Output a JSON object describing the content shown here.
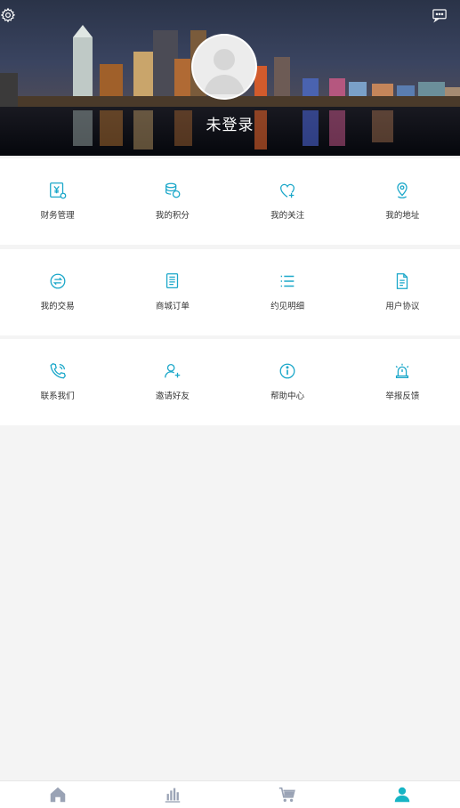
{
  "header": {
    "login_status": "未登录",
    "settings_icon": "gear-icon",
    "message_icon": "chat-bubble-icon"
  },
  "colors": {
    "accent": "#1aa7c9",
    "tab_inactive": "#9aa3b5",
    "tab_active": "#17b4c4",
    "page_bg": "#f4f4f4"
  },
  "menu_groups": [
    {
      "items": [
        {
          "label": "财务管理",
          "icon": "finance-yen-icon"
        },
        {
          "label": "我的积分",
          "icon": "coins-icon"
        },
        {
          "label": "我的关注",
          "icon": "heart-plus-icon"
        },
        {
          "label": "我的地址",
          "icon": "location-pin-icon"
        }
      ]
    },
    {
      "items": [
        {
          "label": "我的交易",
          "icon": "exchange-icon"
        },
        {
          "label": "商城订单",
          "icon": "order-document-icon"
        },
        {
          "label": "约见明细",
          "icon": "list-icon"
        },
        {
          "label": "用户协议",
          "icon": "agreement-file-icon"
        }
      ]
    },
    {
      "items": [
        {
          "label": "联系我们",
          "icon": "phone-icon"
        },
        {
          "label": "邀请好友",
          "icon": "add-user-icon"
        },
        {
          "label": "帮助中心",
          "icon": "info-icon"
        },
        {
          "label": "举报反馈",
          "icon": "alarm-icon"
        }
      ]
    }
  ],
  "tabbar": {
    "tabs": [
      {
        "icon": "home-icon",
        "active": false
      },
      {
        "icon": "bar-chart-icon",
        "active": false
      },
      {
        "icon": "cart-icon",
        "active": false
      },
      {
        "icon": "user-icon",
        "active": true
      }
    ]
  }
}
